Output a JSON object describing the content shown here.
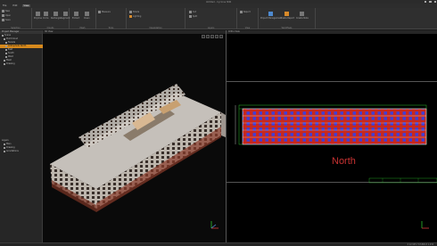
{
  "window": {
    "title": "Untitled - Cyclone 3DR"
  },
  "menu": {
    "items": [
      "File",
      "Edit",
      "View"
    ]
  },
  "ribbon": {
    "groups": [
      {
        "label": "Selection",
        "buttons": [
          "New",
          "Open",
          "Save"
        ]
      },
      {
        "label": "Clouds",
        "buttons": [
          "Polyline",
          "Circle",
          "Rectangle",
          "Segment"
        ]
      },
      {
        "label": "Mesh",
        "buttons": [
          "Extract",
          "Clean"
        ]
      },
      {
        "label": "Tools",
        "buttons": [
          "Measure"
        ]
      },
      {
        "label": "Visualization",
        "buttons": [
          "Shade",
          "Lighting"
        ]
      },
      {
        "label": "Layers",
        "buttons": [
          "Cut",
          "Split"
        ]
      },
      {
        "label": "View",
        "buttons": [
          "Report"
        ]
      },
      {
        "label": "Workflows",
        "buttons": [
          "Project Management",
          "Create Report",
          "Create Note"
        ]
      }
    ]
  },
  "left_panel": {
    "header": "Project Manager",
    "items": [
      {
        "label": "Scene",
        "selected": false,
        "indent": 0
      },
      {
        "label": "Point Cloud",
        "selected": false,
        "indent": 1
      },
      {
        "label": "Facade",
        "selected": false,
        "indent": 2
      },
      {
        "label": "Orthophoto North",
        "selected": true,
        "indent": 2
      },
      {
        "label": "East",
        "selected": false,
        "indent": 2
      },
      {
        "label": "South",
        "selected": false,
        "indent": 2
      },
      {
        "label": "West",
        "selected": false,
        "indent": 2
      },
      {
        "label": "Mesh",
        "selected": false,
        "indent": 1
      },
      {
        "label": "Drawing",
        "selected": false,
        "indent": 1
      }
    ],
    "secondary_header": "Layers",
    "secondary_items": [
      "Main",
      "Drawing",
      "Annotations"
    ]
  },
  "view_left": {
    "tab": "3D View"
  },
  "view_right": {
    "tab": "Ortho View",
    "annotation": "North"
  },
  "status": {
    "text": "X 12.345  Y 67.890  Z 1.234"
  },
  "colors": {
    "facade_fill": "#c8281e",
    "facade_outline": "#e0e0e0",
    "windows": "#3f3fd8",
    "green_lines": "#2cbf2c",
    "accent": "#d78a1d"
  }
}
